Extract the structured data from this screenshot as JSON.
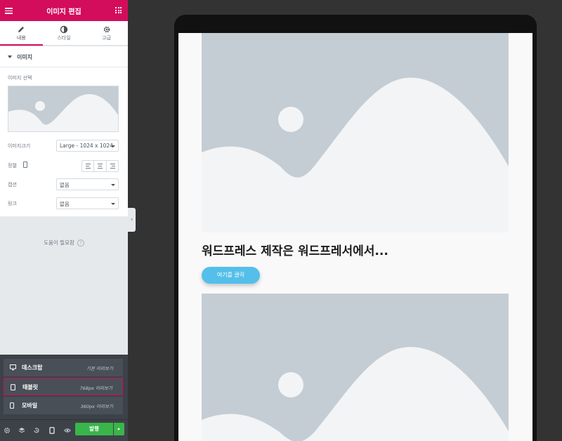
{
  "panel": {
    "header_title": "이미지 편집",
    "tabs": [
      {
        "label": "내용",
        "icon": "pencil-icon",
        "active": true
      },
      {
        "label": "스타일",
        "icon": "half-circle-icon",
        "active": false
      },
      {
        "label": "고급",
        "icon": "gear-icon",
        "active": false
      }
    ],
    "section_title": "이미지",
    "image_select_label": "이미지 선택",
    "image_size": {
      "label": "이미지크기",
      "value": "Large - 1024 x 1024"
    },
    "alignment_label": "정렬",
    "caption": {
      "label": "캡션",
      "value": "없음"
    },
    "link": {
      "label": "링크",
      "value": "없음"
    },
    "help_text": "도움이 필요함",
    "help_icon_glyph": "?",
    "collapse_glyph": "‹"
  },
  "device_menu": {
    "items": [
      {
        "name": "데스크탑",
        "desc": "기본 미리보기",
        "icon": "desktop-icon",
        "active": false
      },
      {
        "name": "태블릿",
        "desc": "768px 미리보기",
        "icon": "tablet-icon",
        "active": true
      },
      {
        "name": "모바일",
        "desc": "360px 미리보기",
        "icon": "mobile-icon",
        "active": false
      }
    ]
  },
  "footer": {
    "publish_label": "발행"
  },
  "preview": {
    "headline": "워드프레스 제작은 워드프레서에서...",
    "button_label": "여기를 클릭"
  },
  "colors": {
    "brand": "#d30c5c",
    "publish": "#39b54a",
    "cta": "#54bfea"
  }
}
